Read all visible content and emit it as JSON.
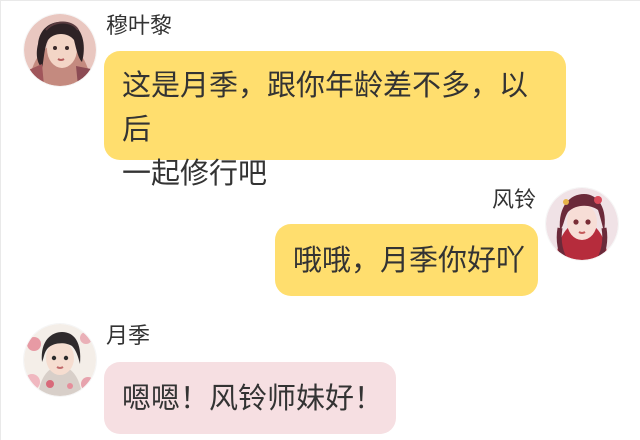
{
  "messages": [
    {
      "sender": "穆叶黎",
      "text_line_1": "这是月季，跟你年龄差不多，以后",
      "text_line_2": "一起修行吧",
      "avatar": "avatar-muyeli",
      "side": "left",
      "bubble_color": "#ffde6e"
    },
    {
      "sender": "风铃",
      "text": "哦哦，月季你好吖",
      "avatar": "avatar-fengling",
      "side": "right",
      "bubble_color": "#ffde6e"
    },
    {
      "sender": "月季",
      "text": "嗯嗯！风铃师妹好！",
      "avatar": "avatar-yueji",
      "side": "left",
      "bubble_color": "#f6dfe2"
    }
  ]
}
